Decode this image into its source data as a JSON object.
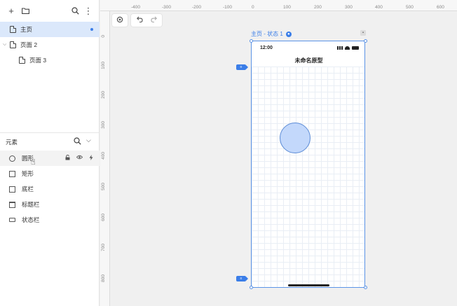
{
  "toolbar": {
    "add": "+",
    "folder": "▭",
    "search": "⌕",
    "more": "⋮"
  },
  "pages": [
    {
      "label": "主页",
      "active": true
    },
    {
      "label": "页面 2",
      "expanded": true
    },
    {
      "label": "页面 3"
    }
  ],
  "elements_panel": {
    "title": "元素",
    "items": [
      {
        "label": "圆形",
        "shape": "circle"
      },
      {
        "label": "矩形",
        "shape": "rect"
      },
      {
        "label": "底栏",
        "shape": "rect"
      },
      {
        "label": "标题栏",
        "shape": "titlebar"
      },
      {
        "label": "状态栏",
        "shape": "statusbar"
      }
    ]
  },
  "ruler_top": [
    "-400",
    "-300",
    "-200",
    "-100",
    "0",
    "100",
    "200",
    "300",
    "400",
    "500",
    "600"
  ],
  "ruler_left": [
    "0",
    "100",
    "200",
    "300",
    "400",
    "500",
    "600",
    "700",
    "800"
  ],
  "frame": {
    "label": "主页 - 状态 1",
    "status_time": "12:00",
    "nav_title": "未命名原型"
  },
  "colors": {
    "accent": "#3b7ee8",
    "circle_fill": "#c3d8fb",
    "selection_bg": "#dbe8fb"
  }
}
